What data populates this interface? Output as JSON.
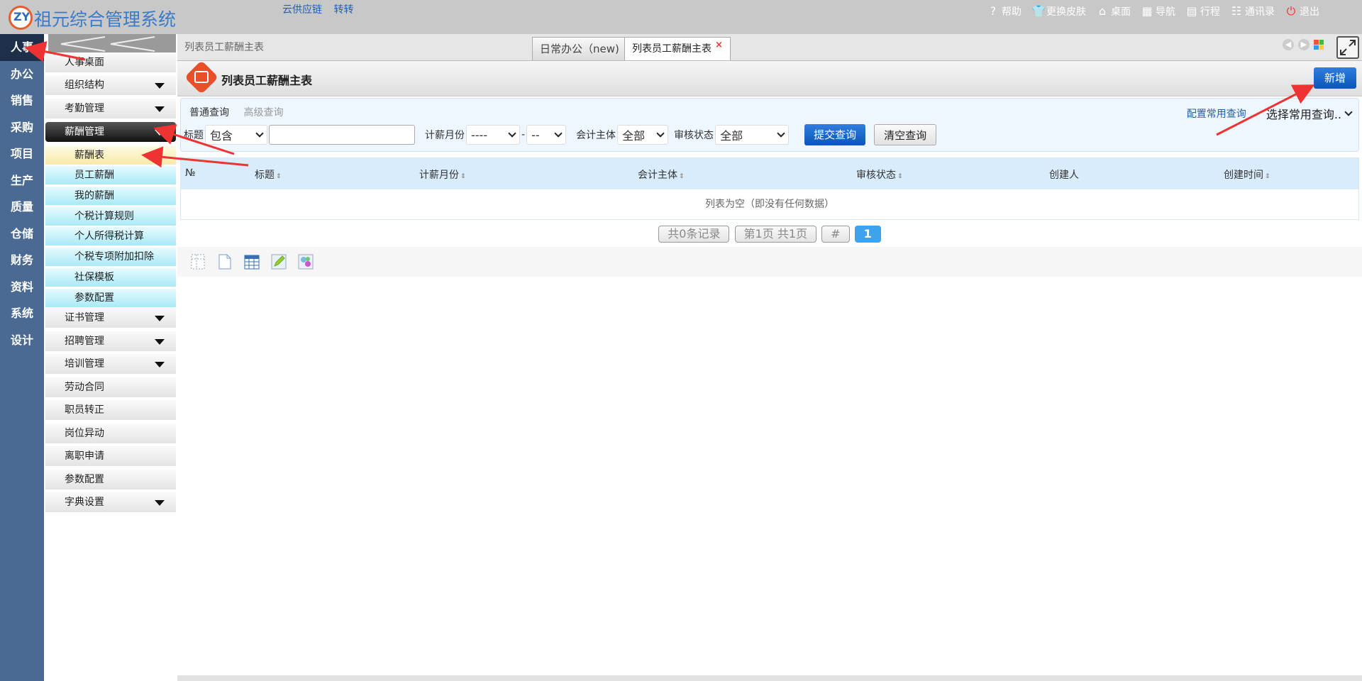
{
  "app": {
    "title": "祖元综合管理系统",
    "logo_text": "ZY",
    "top_links": [
      "云供应链",
      "转转"
    ]
  },
  "top_tools": [
    {
      "label": "帮助",
      "icon": "help-icon"
    },
    {
      "label": "更换皮肤",
      "icon": "shirt-icon"
    },
    {
      "label": "桌面",
      "icon": "home-icon"
    },
    {
      "label": "导航",
      "icon": "grid-icon"
    },
    {
      "label": "行程",
      "icon": "calendar-icon"
    },
    {
      "label": "通讯录",
      "icon": "contacts-icon"
    },
    {
      "label": "退出",
      "icon": "power-icon"
    }
  ],
  "modules": [
    "人事",
    "办公",
    "销售",
    "采购",
    "项目",
    "生产",
    "质量",
    "仓储",
    "财务",
    "资料",
    "系统",
    "设计"
  ],
  "sidebar": {
    "items": [
      {
        "label": "人事桌面"
      },
      {
        "label": "组织结构"
      },
      {
        "label": "考勤管理"
      },
      {
        "label": "薪酬管理"
      }
    ],
    "sub_items": [
      "薪酬表",
      "员工薪酬",
      "我的薪酬",
      "个税计算规则",
      "个人所得税计算",
      "个税专项附加扣除",
      "社保模板",
      "参数配置"
    ],
    "more_items": [
      {
        "label": "证书管理"
      },
      {
        "label": "招聘管理"
      },
      {
        "label": "培训管理"
      },
      {
        "label": "劳动合同"
      },
      {
        "label": "职员转正"
      },
      {
        "label": "岗位异动"
      },
      {
        "label": "离职申请"
      },
      {
        "label": "参数配置"
      },
      {
        "label": "字典设置"
      }
    ]
  },
  "tabs": {
    "breadcrumb": "列表员工薪酬主表",
    "items": [
      "日常办公（new)",
      "列表员工薪酬主表"
    ],
    "close_mark": "×"
  },
  "page": {
    "title": "列表员工薪酬主表",
    "add_button": "新增"
  },
  "query": {
    "tab_normal": "普通查询",
    "tab_advanced": "高级查询",
    "config_link": "配置常用查询",
    "common_select": "选择常用查询..",
    "title_label": "标题",
    "title_op": "包含",
    "title_value": "",
    "month_label": "计薪月份",
    "month_year": "----",
    "month_dash": "-",
    "month_month": "--",
    "entity_label": "会计主体",
    "entity_value": "全部",
    "status_label": "审核状态",
    "status_value": "全部",
    "submit": "提交查询",
    "clear": "清空查询"
  },
  "table": {
    "columns": [
      "№",
      "标题",
      "计薪月份",
      "会计主体",
      "审核状态",
      "创建人",
      "创建时间"
    ],
    "sort_mark": "⇕",
    "empty_text": "列表为空（即没有任何数据）"
  },
  "pager": {
    "total": "共0条记录",
    "pages": "第1页 共1页",
    "hash": "#",
    "current": "1"
  },
  "colors": {
    "accent": "#0b56b8",
    "modnav": "#4a6a94",
    "header": "#c8c8c8",
    "danger": "#e33333"
  }
}
